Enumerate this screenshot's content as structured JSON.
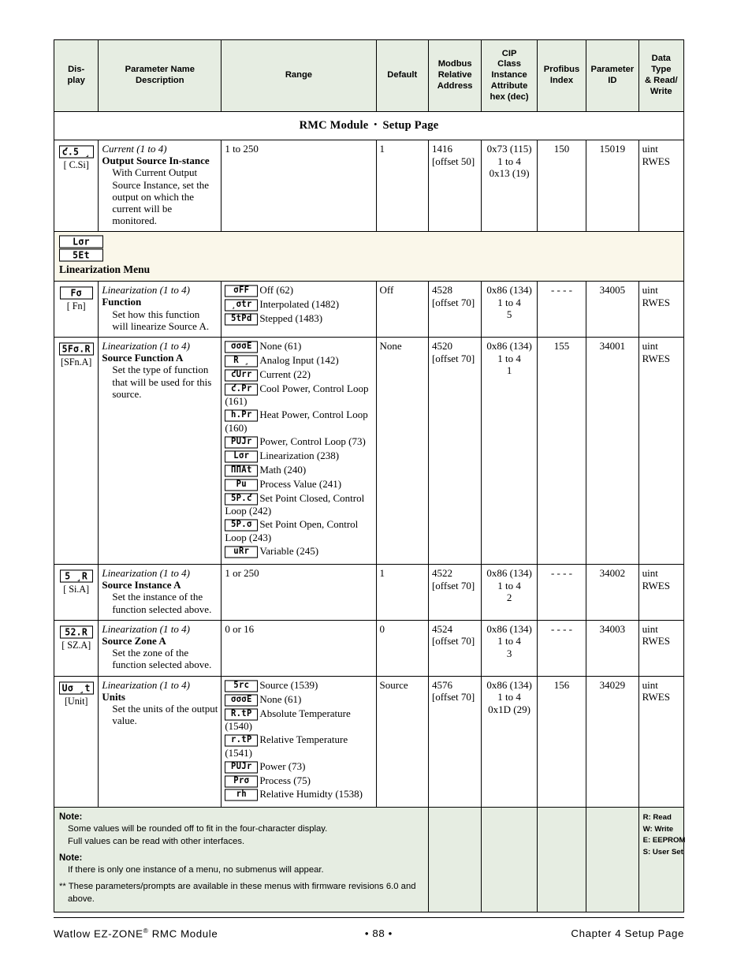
{
  "doc": {
    "title_main": "RMC Module",
    "title_sep": "•",
    "title_sub": "Setup Page"
  },
  "columns": {
    "display": "Dis-\nplay",
    "display_l1": "Dis-",
    "display_l2": "play",
    "param_l1": "Parameter Name",
    "param_l2": "Description",
    "range": "Range",
    "default": "Default",
    "modbus_l1": "Modbus",
    "modbus_l2": "Relative",
    "modbus_l3": "Address",
    "cip_l1": "CIP",
    "cip_l2": "Class",
    "cip_l3": "Instance",
    "cip_l4": "Attribute",
    "cip_l5": "hex (dec)",
    "profibus_l1": "Profibus",
    "profibus_l2": "Index",
    "paramid_l1": "Parameter",
    "paramid_l2": "ID",
    "datatype_l1": "Data",
    "datatype_l2": "Type",
    "datatype_l3": "& Read/",
    "datatype_l4": "Write"
  },
  "rows": [
    {
      "lcd": "ƈ.5 ¸",
      "lcd_sub": "[ C.Si]",
      "param_italic": "Current (1 to 4)",
      "param_bold": "Output Source In-stance",
      "param_desc": "With Current Output Source Instance, set the output on which the current will be monitored.",
      "range_plain": "1 to 250",
      "default": "1",
      "modbus_l1": "1416",
      "modbus_l2": "[offset 50]",
      "cip_l1": "0x73 (115)",
      "cip_l2": "1 to 4",
      "cip_l3": "0x13 (19)",
      "profibus": "150",
      "param_id": "15019",
      "dtype_l1": "uint",
      "dtype_l2": "RWES"
    },
    {
      "lcd": "5 ¸R",
      "lcd_sub": "[ Si.A]",
      "param_italic": "Linearization (1 to 4)",
      "param_bold": "Source Instance A",
      "param_desc": "Set the instance of the function selected above.",
      "range_plain": "1 or 250",
      "default": "1",
      "modbus_l1": "4522",
      "modbus_l2": "[offset 70]",
      "cip_l1": "0x86 (134)",
      "cip_l2": "1 to 4",
      "cip_l3": "2",
      "profibus": "- - - -",
      "param_id": "34002",
      "dtype_l1": "uint",
      "dtype_l2": "RWES"
    }
  ],
  "menu_band": {
    "lcd_1": "Lσr",
    "lcd_2": "5Et",
    "title": "Linearization Menu"
  },
  "row_function": {
    "lcd": "Fσ",
    "lcd_sub": "[  Fn]",
    "param_italic": "Linearization (1 to 4)",
    "param_bold": "Function",
    "param_desc": "Set how this function will linearize Source A.",
    "options": [
      {
        "lcd": "σFF",
        "label": "Off (62)"
      },
      {
        "lcd": "¸σtr",
        "label": "Interpolated (1482)"
      },
      {
        "lcd": "5tPd",
        "label": "Stepped (1483)"
      }
    ],
    "default": "Off",
    "modbus_l1": "4528",
    "modbus_l2": "[offset 70]",
    "cip_l1": "0x86 (134)",
    "cip_l2": "1 to 4",
    "cip_l3": "5",
    "profibus": "- - - -",
    "param_id": "34005",
    "dtype_l1": "uint",
    "dtype_l2": "RWES"
  },
  "row_sfna": {
    "lcd": "5Fσ.R",
    "lcd_sub": "[SFn.A]",
    "param_italic": "Linearization (1 to 4)",
    "param_bold": "Source Function A",
    "param_desc": "Set the type of function that will be used for this source.",
    "options": [
      {
        "lcd": "σσσE",
        "label": "None (61)"
      },
      {
        "lcd": "R ¸",
        "label": "Analog Input (142)"
      },
      {
        "lcd": "ƈUrr",
        "label": "Current (22)"
      },
      {
        "lcd": "ƈ.Pr",
        "label": "Cool Power, Control Loop (161)"
      },
      {
        "lcd": "h.Pr",
        "label": "Heat Power, Control Loop (160)"
      },
      {
        "lcd": "PUJr",
        "label": "Power, Control Loop (73)"
      },
      {
        "lcd": "Lσr",
        "label": "Linearization (238)"
      },
      {
        "lcd": "ΠΠAt",
        "label": "Math (240)"
      },
      {
        "lcd": "Pu",
        "label": "Process Value (241)"
      },
      {
        "lcd": "5P.ƈ",
        "label": "Set Point Closed, Control Loop (242)"
      },
      {
        "lcd": "5P.σ",
        "label": "Set Point Open, Control Loop (243)"
      },
      {
        "lcd": "uRr",
        "label": "Variable (245)"
      }
    ],
    "default": "None",
    "modbus_l1": "4520",
    "modbus_l2": "[offset 70]",
    "cip_l1": "0x86 (134)",
    "cip_l2": "1 to 4",
    "cip_l3": "1",
    "profibus": "155",
    "param_id": "34001",
    "dtype_l1": "uint",
    "dtype_l2": "RWES"
  },
  "row_sza": {
    "lcd": "52.R",
    "lcd_sub": "[ SZ.A]",
    "param_italic": "Linearization (1 to 4)",
    "param_bold": "Source Zone A",
    "param_desc": "Set the zone of the function selected above.",
    "range_plain": "0 or 16",
    "default": "0",
    "modbus_l1": "4524",
    "modbus_l2": "[offset 70]",
    "cip_l1": "0x86 (134)",
    "cip_l2": "1 to 4",
    "cip_l3": "3",
    "profibus": "- - - -",
    "param_id": "34003",
    "dtype_l1": "uint",
    "dtype_l2": "RWES"
  },
  "row_unit": {
    "lcd": "Uσ ¸t",
    "lcd_sub": "[Unit]",
    "param_italic": "Linearization (1 to 4)",
    "param_bold": "Units",
    "param_desc": "Set the units of the output value.",
    "options": [
      {
        "lcd": "5rc",
        "label": "Source (1539)"
      },
      {
        "lcd": "σσσE",
        "label": "None (61)"
      },
      {
        "lcd": "R.tP",
        "label": "Absolute Temperature (1540)"
      },
      {
        "lcd": "r.tP",
        "label": "Relative Temperature (1541)"
      },
      {
        "lcd": "PUJr",
        "label": "Power (73)"
      },
      {
        "lcd": "Prσ",
        "label": "Process (75)"
      },
      {
        "lcd": "rh",
        "label": "Relative Humidty (1538)"
      }
    ],
    "default": "Source",
    "modbus_l1": "4576",
    "modbus_l2": "[offset 70]",
    "cip_l1": "0x86 (134)",
    "cip_l2": "1 to 4",
    "cip_l3": "0x1D (29)",
    "profibus": "156",
    "param_id": "34029",
    "dtype_l1": "uint",
    "dtype_l2": "RWES"
  },
  "notes": {
    "note1_head": "Note:",
    "note1_line1": "Some values will be rounded off to fit in the four-character display.",
    "note1_line2": "Full values can be read with other interfaces.",
    "note2_head": "Note:",
    "note2_line1": "If there is only one instance of a menu, no submenus will appear.",
    "note3_line1": "** These parameters/prompts are available in these menus with firmware revisions 6.0 and above."
  },
  "legend": {
    "r": "R: Read",
    "w": "W: Write",
    "e": "E: EEPROM",
    "s": "S: User Set"
  },
  "footer": {
    "left_pre": "Watlow EZ-ZONE",
    "left_sup": "®",
    "left_post": " RMC Module",
    "center": "•  88  •",
    "right": "Chapter 4 Setup Page"
  }
}
